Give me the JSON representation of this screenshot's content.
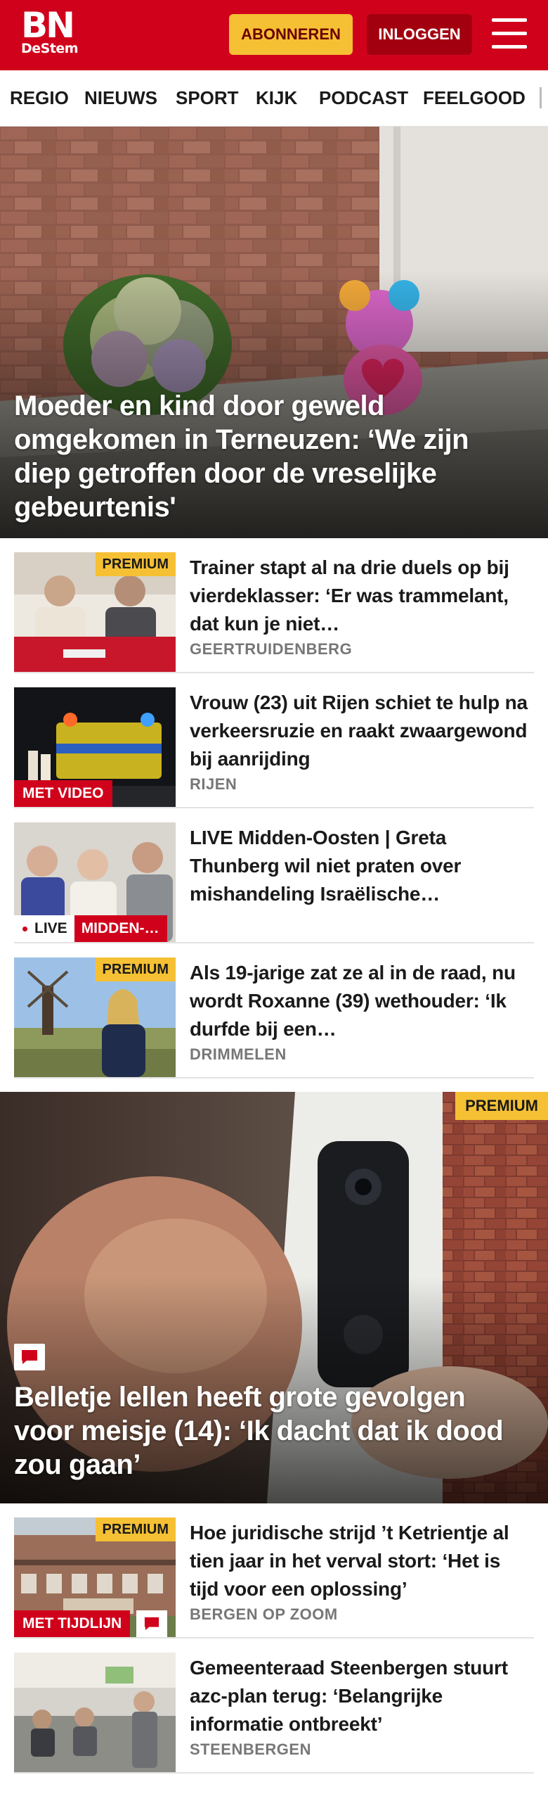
{
  "header": {
    "logo_main": "BN",
    "logo_sub": "DeStem",
    "subscribe_label": "ABONNEREN",
    "login_label": "INLOGGEN",
    "menu_icon": "hamburger-menu-icon"
  },
  "nav": {
    "items": [
      "REGIO",
      "NIEUWS",
      "SPORT",
      "KIJK",
      "PODCAST",
      "FEELGOOD"
    ]
  },
  "hero": {
    "title": "Moeder en kind door geweld omgekomen in Terneuzen: ‘We zijn diep getroffen door de vreselijke gebeurtenis'"
  },
  "articles": [
    {
      "badge": "PREMIUM",
      "title": "Trainer stapt al na drie duels op bij vierdeklasser: ‘Er was trammelant, dat kun je niet…",
      "location": "GEERTRUIDENBERG"
    },
    {
      "badge": "MET VIDEO",
      "title": "Vrouw (23) uit Rijen schiet te hulp na verkeersruzie en raakt zwaargewond bij aanrijding",
      "location": "RIJEN"
    },
    {
      "live_label": "LIVE",
      "topic": "MIDDEN-…",
      "title": "LIVE Midden-Oosten | Greta Thunberg wil niet praten over mishandeling Israëlische…"
    },
    {
      "badge": "PREMIUM",
      "title": "Als 19-jarige zat ze al in de raad, nu wordt Roxanne (39) wethouder: ‘Ik durfde bij een…",
      "location": "DRIMMELEN"
    }
  ],
  "hero2": {
    "badge": "PREMIUM",
    "comment_icon": "comment-icon",
    "title": "Belletje lellen heeft grote gevolgen voor meisje (14): ‘Ik dacht dat ik dood zou gaan’"
  },
  "articles2": [
    {
      "badge": "PREMIUM",
      "label": "MET TIJDLIJN",
      "comment_icon": "comment-icon",
      "title": "Hoe juridische strijd ’t Ketrientje al tien jaar in het verval stort: ‘Het is tijd voor een oplossing’",
      "location": "BERGEN OP ZOOM"
    },
    {
      "title": "Gemeenteraad Steenbergen stuurt azc-plan terug: ‘Belangrij­ke informatie ontbreekt’",
      "location": "STEENBERGEN"
    }
  ],
  "colors": {
    "brand_red": "#d0021b",
    "premium_yellow": "#f5c033",
    "login_dark_red": "#a3000f"
  }
}
